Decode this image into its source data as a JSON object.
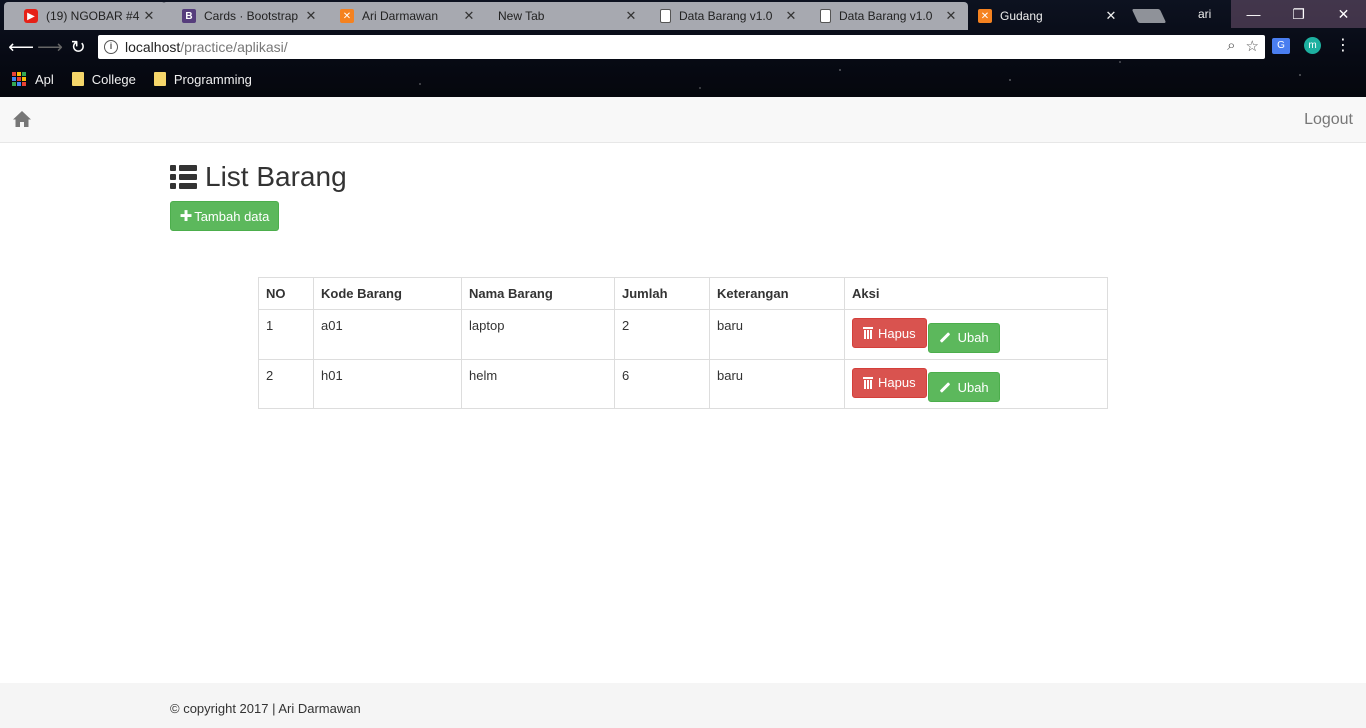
{
  "browser": {
    "tabs": [
      {
        "title": "(19) NGOBAR #4 :",
        "favicon": "youtube-icon",
        "active": false
      },
      {
        "title": "Cards · Bootstrap",
        "favicon": "bootstrap-icon",
        "active": false
      },
      {
        "title": "Ari Darmawan",
        "favicon": "xampp-icon",
        "active": false
      },
      {
        "title": "New Tab",
        "favicon": "",
        "active": false
      },
      {
        "title": "Data Barang v1.0",
        "favicon": "document-icon",
        "active": false
      },
      {
        "title": "Data Barang v1.0",
        "favicon": "document-icon",
        "active": false
      },
      {
        "title": "Gudang",
        "favicon": "xampp-icon",
        "active": true
      }
    ],
    "profile_name": "ari",
    "address": {
      "host": "localhost",
      "path": "/practice/aplikasi/"
    },
    "bookmarks": [
      {
        "label": "Apl",
        "icon": "apps-grid-icon"
      },
      {
        "label": "College",
        "icon": "folder-icon"
      },
      {
        "label": "Programming",
        "icon": "folder-icon"
      }
    ]
  },
  "navbar": {
    "logout_label": "Logout"
  },
  "main": {
    "title": "List Barang",
    "add_button_label": "Tambah data",
    "table": {
      "headers": [
        "NO",
        "Kode Barang",
        "Nama Barang",
        "Jumlah",
        "Keterangan",
        "Aksi"
      ],
      "rows": [
        {
          "no": "1",
          "kode": "a01",
          "nama": "laptop",
          "jumlah": "2",
          "keterangan": "baru"
        },
        {
          "no": "2",
          "kode": "h01",
          "nama": "helm",
          "jumlah": "6",
          "keterangan": "baru"
        }
      ],
      "delete_label": "Hapus",
      "edit_label": "Ubah"
    }
  },
  "footer": {
    "text": "© copyright 2017 | Ari Darmawan"
  },
  "colors": {
    "success": "#5cb85c",
    "danger": "#d9534f",
    "navbar_bg": "#f8f8f8"
  }
}
